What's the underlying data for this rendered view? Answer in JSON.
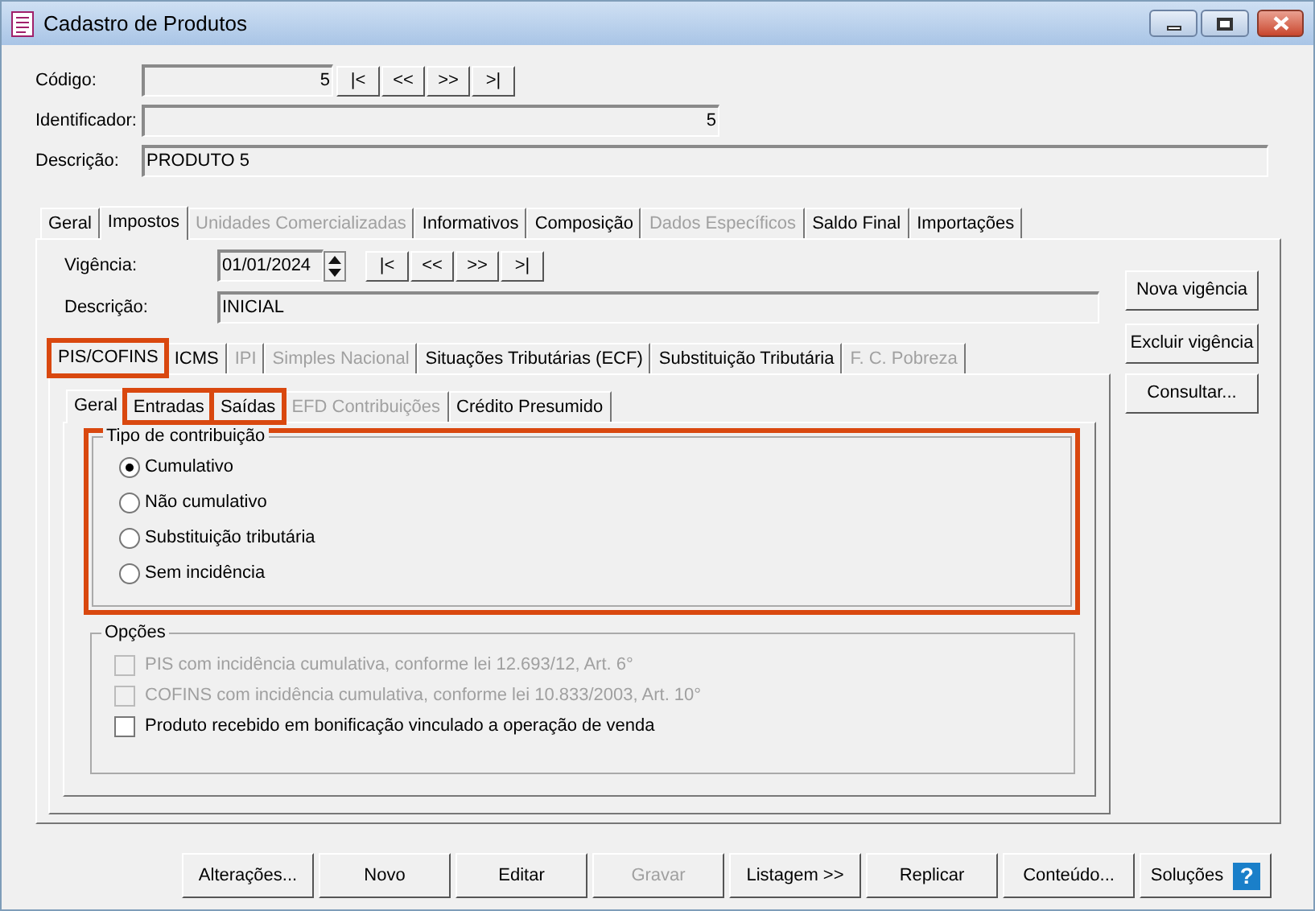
{
  "window": {
    "title": "Cadastro de Produtos"
  },
  "header": {
    "codigo": {
      "label": "Código:",
      "value": "5"
    },
    "record_nav": [
      "|<",
      "<<",
      ">>",
      ">|"
    ],
    "identificador": {
      "label": "Identificador:",
      "value": "5"
    },
    "descricao": {
      "label": "Descrição:",
      "value": "PRODUTO 5"
    }
  },
  "main_tabs": [
    {
      "label": "Geral",
      "selected": false,
      "disabled": false
    },
    {
      "label": "Impostos",
      "selected": true,
      "disabled": false
    },
    {
      "label": "Unidades Comercializadas",
      "selected": false,
      "disabled": true
    },
    {
      "label": "Informativos",
      "selected": false,
      "disabled": false
    },
    {
      "label": "Composição",
      "selected": false,
      "disabled": false
    },
    {
      "label": "Dados Específicos",
      "selected": false,
      "disabled": true
    },
    {
      "label": "Saldo Final",
      "selected": false,
      "disabled": false
    },
    {
      "label": "Importações",
      "selected": false,
      "disabled": false
    }
  ],
  "vigencia": {
    "label": "Vigência:",
    "value": "01/01/2024",
    "nav": [
      "|<",
      "<<",
      ">>",
      ">|"
    ]
  },
  "vigencia_descricao": {
    "label": "Descrição:",
    "value": "INICIAL"
  },
  "side_buttons": [
    "Nova vigência",
    "Excluir vigência",
    "Consultar..."
  ],
  "tax_tabs": [
    {
      "label": "PIS/COFINS",
      "selected": true,
      "disabled": false,
      "highlighted": true
    },
    {
      "label": "ICMS",
      "selected": false,
      "disabled": false,
      "highlighted": false
    },
    {
      "label": "IPI",
      "selected": false,
      "disabled": true,
      "highlighted": false
    },
    {
      "label": "Simples Nacional",
      "selected": false,
      "disabled": true,
      "highlighted": false
    },
    {
      "label": "Situações Tributárias (ECF)",
      "selected": false,
      "disabled": false,
      "highlighted": false
    },
    {
      "label": "Substituição Tributária",
      "selected": false,
      "disabled": false,
      "highlighted": false
    },
    {
      "label": "F. C. Pobreza",
      "selected": false,
      "disabled": true,
      "highlighted": false
    }
  ],
  "sub_tabs": [
    {
      "label": "Geral",
      "selected": true,
      "disabled": false,
      "highlighted": false
    },
    {
      "label": "Entradas",
      "selected": false,
      "disabled": false,
      "highlighted": true
    },
    {
      "label": "Saídas",
      "selected": false,
      "disabled": false,
      "highlighted": true
    },
    {
      "label": "EFD Contribuições",
      "selected": false,
      "disabled": true,
      "highlighted": false
    },
    {
      "label": "Crédito Presumido",
      "selected": false,
      "disabled": false,
      "highlighted": false
    }
  ],
  "tipo_contribuicao": {
    "title": "Tipo de contribuição",
    "highlighted": true,
    "options": [
      {
        "label": "Cumulativo",
        "selected": true
      },
      {
        "label": "Não cumulativo",
        "selected": false
      },
      {
        "label": "Substituição tributária",
        "selected": false
      },
      {
        "label": "Sem incidência",
        "selected": false
      }
    ]
  },
  "opcoes": {
    "title": "Opções",
    "options": [
      {
        "label": "PIS com incidência cumulativa, conforme lei 12.693/12, Art. 6°",
        "checked": false,
        "disabled": true
      },
      {
        "label": "COFINS com incidência cumulativa, conforme lei 10.833/2003, Art. 10°",
        "checked": false,
        "disabled": true
      },
      {
        "label": "Produto recebido em bonificação vinculado a operação de venda",
        "checked": false,
        "disabled": false
      }
    ]
  },
  "buttons": [
    {
      "label": "Alterações...",
      "disabled": false
    },
    {
      "label": "Novo",
      "disabled": false
    },
    {
      "label": "Editar",
      "disabled": false
    },
    {
      "label": "Gravar",
      "disabled": true
    },
    {
      "label": "Listagem >>",
      "disabled": false
    },
    {
      "label": "Replicar",
      "disabled": false
    },
    {
      "label": "Conteúdo...",
      "disabled": false
    },
    {
      "label": "Soluções",
      "disabled": false,
      "help_glyph": "?"
    }
  ]
}
